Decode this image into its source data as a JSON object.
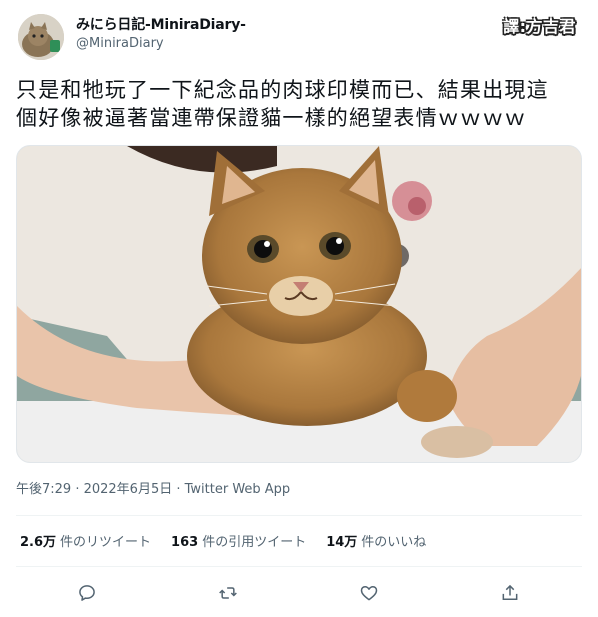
{
  "author": {
    "display_name": "みにら日記-MiniraDiary-",
    "handle": "@MiniraDiary"
  },
  "translator_tag": "譯:方吉君",
  "tweet": {
    "text_line1": "只是和牠玩了一下紀念品的肉球印模而已、結果出現這",
    "text_line2": "個好像被逼著當連帶保證貓一樣的絕望表情ｗｗｗｗ"
  },
  "meta": {
    "timestamp": "午後7:29 · 2022年6月5日 · Twitter Web App"
  },
  "stats": [
    {
      "count": "2.6万",
      "label": "件のリツイート"
    },
    {
      "count": "163",
      "label": "件の引用ツイート"
    },
    {
      "count": "14万",
      "label": "件のいいね"
    }
  ],
  "actions": [
    "reply-icon",
    "retweet-icon",
    "like-icon",
    "share-icon"
  ],
  "colors": {
    "text": "#0f1419",
    "secondary": "#536471",
    "divider": "#eff3f4"
  }
}
